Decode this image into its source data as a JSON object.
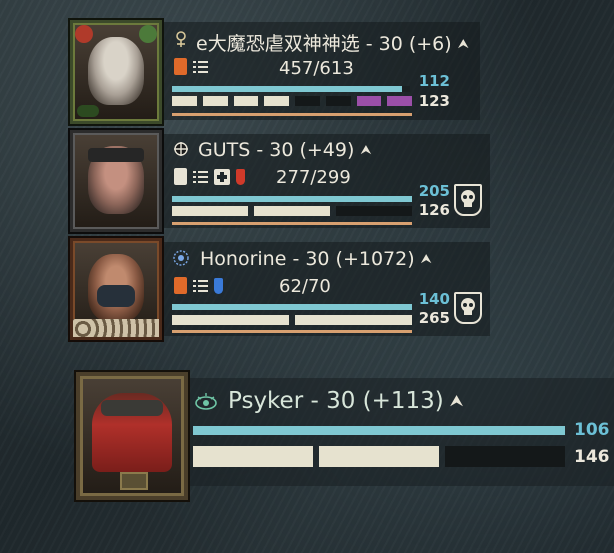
{
  "colors": {
    "toughness": "#7fc8d2",
    "toughness_text": "#6cc0d6",
    "health": "#e6e2cf",
    "corruption": "#9b4fa8",
    "grenade": "#e06a2a",
    "stim_red": "#d03a2a",
    "stim_blue": "#3a7ad8"
  },
  "players": [
    {
      "name": "e大魔恐虐双神神选 - 30 (+6)",
      "class_icon": "veteran-icon",
      "ammo": "457/613",
      "toughness": "112",
      "health": "123",
      "icons": [
        "grenade-icon",
        "ammo-list-icon"
      ],
      "toughness_fill": 0.96,
      "health_segments": [
        "full",
        "full",
        "full",
        "full",
        "empty",
        "empty",
        "corrupted",
        "corrupted"
      ],
      "downed_icon": null
    },
    {
      "name": "GUTS - 30 (+49)",
      "class_icon": "zealot-icon",
      "ammo": "277/299",
      "toughness": "205",
      "health": "126",
      "icons": [
        "grenade-icon",
        "ammo-list-icon",
        "medkit-icon",
        "red-stimm-icon"
      ],
      "toughness_fill": 1.0,
      "health_segments": [
        "full",
        "full",
        "empty"
      ],
      "downed_icon": "skull-icon"
    },
    {
      "name": "Honorine - 30 (+1072)",
      "class_icon": "psyker-icon",
      "ammo": "62/70",
      "toughness": "140",
      "health": "265",
      "icons": [
        "grenade-icon",
        "ammo-list-icon",
        "blue-stimm-icon"
      ],
      "toughness_fill": 1.0,
      "health_segments": [
        "full",
        "full"
      ],
      "downed_icon": "skull-icon"
    }
  ],
  "self": {
    "name": "Psyker - 30 (+113)",
    "class_icon": "psyker-eye-icon",
    "toughness": "106",
    "health": "146",
    "toughness_fill": 1.0,
    "health_segments": [
      "full",
      "full",
      "empty"
    ]
  }
}
